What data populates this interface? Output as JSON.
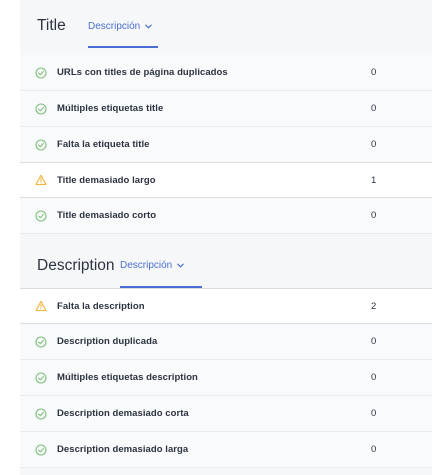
{
  "sections": [
    {
      "title": "Title",
      "tab_label": "Descripción",
      "rows": [
        {
          "label": "URLs con titles de página duplicados",
          "count": "0",
          "status": "ok"
        },
        {
          "label": "Múltiples etiquetas title",
          "count": "0",
          "status": "ok"
        },
        {
          "label": "Falta la etiqueta title",
          "count": "0",
          "status": "ok"
        },
        {
          "label": "Title demasiado largo",
          "count": "1",
          "status": "warning"
        },
        {
          "label": "Title demasiado corto",
          "count": "0",
          "status": "ok"
        }
      ]
    },
    {
      "title": "Description",
      "tab_label": "Descripción",
      "rows": [
        {
          "label": "Falta la description",
          "count": "2",
          "status": "warning"
        },
        {
          "label": "Description duplicada",
          "count": "0",
          "status": "ok"
        },
        {
          "label": "Múltiples etiquetas description",
          "count": "0",
          "status": "ok"
        },
        {
          "label": "Description demasiado corta",
          "count": "0",
          "status": "ok"
        },
        {
          "label": "Description demasiado larga",
          "count": "0",
          "status": "ok"
        }
      ]
    }
  ],
  "colors": {
    "accent": "#4a6fd1",
    "ok": "#7cc07a",
    "warning": "#f2b43c"
  }
}
